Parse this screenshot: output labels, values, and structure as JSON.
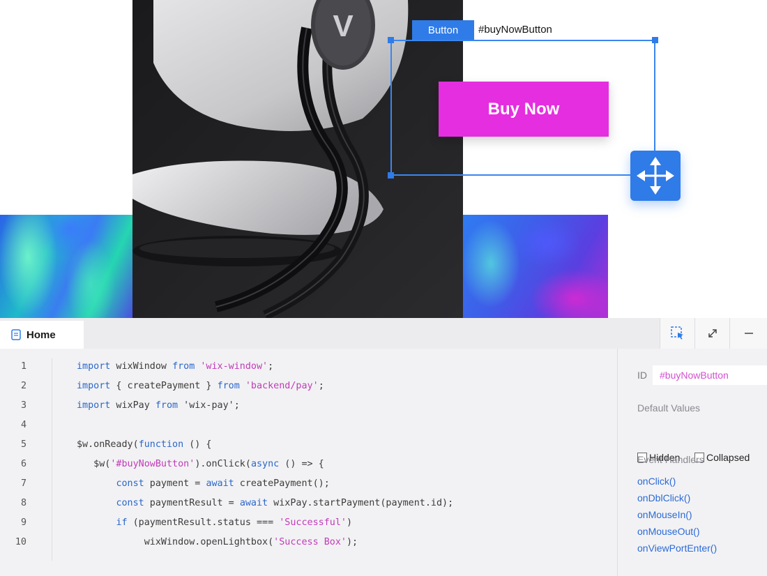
{
  "canvas": {
    "element_type_tag": "Button",
    "element_id_tag": "#buyNowButton",
    "buy_now_label": "Buy Now",
    "product_logo_letter": "V"
  },
  "code_panel": {
    "tab_label": "Home",
    "toolbar": {
      "select_icon": "select-element-icon",
      "expand_icon": "expand-icon",
      "minimize_icon": "minimize-icon"
    },
    "code_lines": [
      {
        "n": "1",
        "tokens": [
          {
            "t": "import",
            "c": "kw"
          },
          {
            "t": " wixWindow ",
            "c": "txt"
          },
          {
            "t": "from",
            "c": "kw"
          },
          {
            "t": " ",
            "c": "txt"
          },
          {
            "t": "'wix-window'",
            "c": "str"
          },
          {
            "t": ";",
            "c": "txt"
          }
        ]
      },
      {
        "n": "2",
        "tokens": [
          {
            "t": "import",
            "c": "kw"
          },
          {
            "t": " { createPayment } ",
            "c": "txt"
          },
          {
            "t": "from",
            "c": "kw"
          },
          {
            "t": " ",
            "c": "txt"
          },
          {
            "t": "'backend/pay'",
            "c": "str"
          },
          {
            "t": ";",
            "c": "txt"
          }
        ]
      },
      {
        "n": "3",
        "tokens": [
          {
            "t": "import",
            "c": "kw"
          },
          {
            "t": " wixPay ",
            "c": "txt"
          },
          {
            "t": "from",
            "c": "kw"
          },
          {
            "t": " 'wix-pay';",
            "c": "txt"
          }
        ]
      },
      {
        "n": "4",
        "tokens": []
      },
      {
        "n": "5",
        "tokens": [
          {
            "t": "$w.onReady(",
            "c": "txt"
          },
          {
            "t": "function",
            "c": "kw"
          },
          {
            "t": " () {",
            "c": "txt"
          }
        ]
      },
      {
        "n": "6",
        "tokens": [
          {
            "t": "   $w(",
            "c": "txt"
          },
          {
            "t": "'#buyNowButton'",
            "c": "str"
          },
          {
            "t": ").onClick(",
            "c": "txt"
          },
          {
            "t": "async",
            "c": "kw"
          },
          {
            "t": " () => {",
            "c": "txt"
          }
        ]
      },
      {
        "n": "7",
        "tokens": [
          {
            "t": "       ",
            "c": "txt"
          },
          {
            "t": "const",
            "c": "kw"
          },
          {
            "t": " payment = ",
            "c": "txt"
          },
          {
            "t": "await",
            "c": "kw"
          },
          {
            "t": " createPayment();",
            "c": "txt"
          }
        ]
      },
      {
        "n": "8",
        "tokens": [
          {
            "t": "       ",
            "c": "txt"
          },
          {
            "t": "const",
            "c": "kw"
          },
          {
            "t": " paymentResult = ",
            "c": "txt"
          },
          {
            "t": "await",
            "c": "kw"
          },
          {
            "t": " wixPay.startPayment(payment.id);",
            "c": "txt"
          }
        ]
      },
      {
        "n": "9",
        "tokens": [
          {
            "t": "       ",
            "c": "txt"
          },
          {
            "t": "if",
            "c": "kw"
          },
          {
            "t": " (paymentResult.status === ",
            "c": "txt"
          },
          {
            "t": "'Successful'",
            "c": "str"
          },
          {
            "t": ")",
            "c": "txt"
          }
        ]
      },
      {
        "n": "10",
        "tokens": [
          {
            "t": "            wixWindow.openLightbox(",
            "c": "txt"
          },
          {
            "t": "'Success Box'",
            "c": "str"
          },
          {
            "t": ");",
            "c": "txt"
          }
        ]
      }
    ]
  },
  "properties": {
    "id_label": "ID",
    "id_value": "#buyNowButton",
    "default_values_label": "Default Values",
    "hidden_label": "Hidden",
    "collapsed_label": "Collapsed",
    "event_handlers_label": "Event Handlers",
    "handlers": [
      "onClick()",
      "onDblClick()",
      "onMouseIn()",
      "onMouseOut()",
      "onViewPortEnter()"
    ]
  },
  "colors": {
    "accent_blue": "#2f7be8",
    "button_magenta": "#e52ee0",
    "keyword_blue": "#2b67c9",
    "string_magenta": "#c13bb8"
  }
}
